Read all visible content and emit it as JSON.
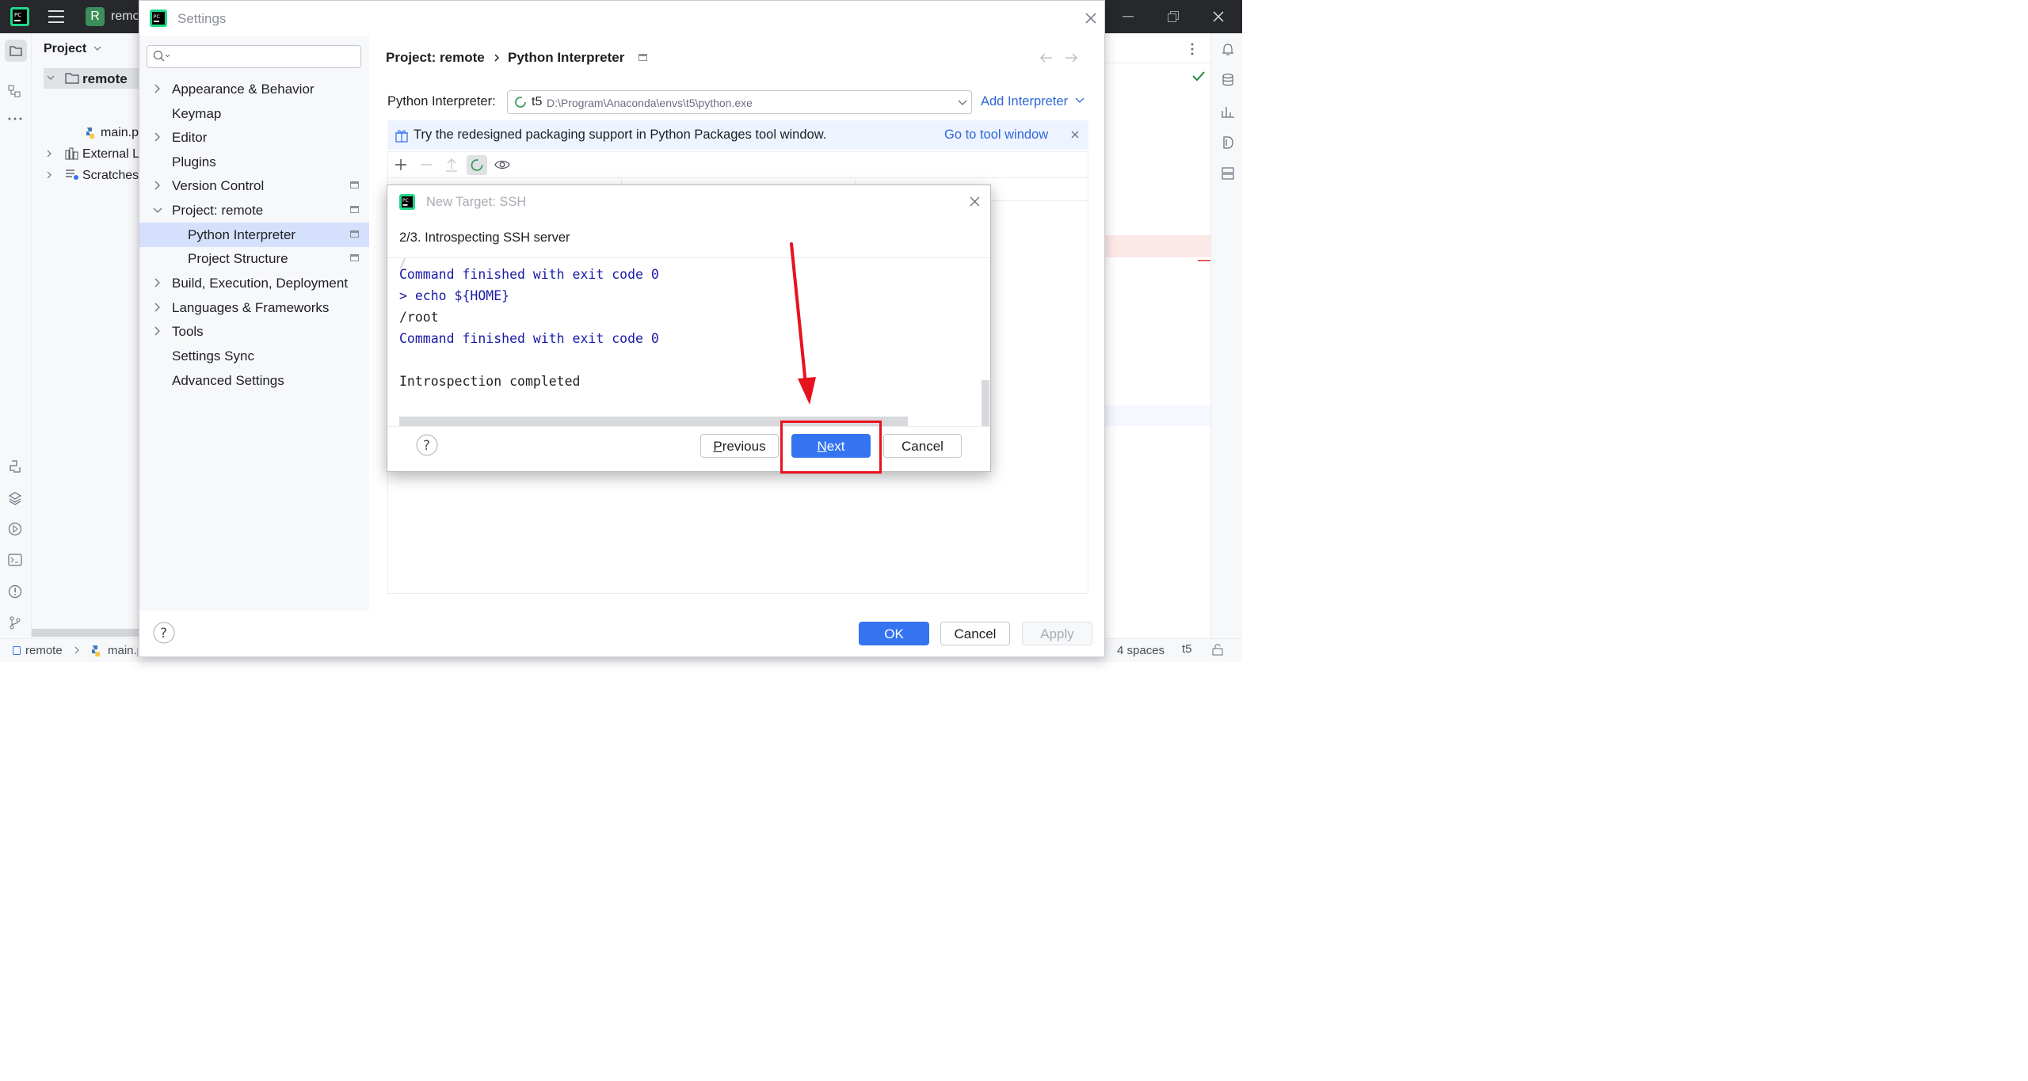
{
  "ide": {
    "project_chip_letter": "R",
    "project_name": "remote",
    "project_panel_title": "Project",
    "tree": [
      {
        "label": "remote"
      },
      {
        "label": "main.py"
      },
      {
        "label": "External Libraries"
      },
      {
        "label": "Scratches and Consoles"
      }
    ],
    "status": {
      "crumb_project": "remote",
      "crumb_file": "main.py",
      "indent": "4 spaces",
      "interpreter": "t5"
    }
  },
  "settings": {
    "title": "Settings",
    "search_placeholder": "",
    "nav": [
      {
        "label": "Appearance & Behavior",
        "expandable": true
      },
      {
        "label": "Keymap"
      },
      {
        "label": "Editor",
        "expandable": true
      },
      {
        "label": "Plugins"
      },
      {
        "label": "Version Control",
        "expandable": true
      },
      {
        "label": "Project: remote",
        "expanded": true
      },
      {
        "label": "Python Interpreter",
        "selected": true
      },
      {
        "label": "Project Structure"
      },
      {
        "label": "Build, Execution, Deployment",
        "expandable": true
      },
      {
        "label": "Languages & Frameworks",
        "expandable": true
      },
      {
        "label": "Tools",
        "expandable": true
      },
      {
        "label": "Settings Sync"
      },
      {
        "label": "Advanced Settings"
      }
    ],
    "breadcrumb": {
      "project": "Project: remote",
      "page": "Python Interpreter"
    },
    "interpreter_label": "Python Interpreter:",
    "interpreter_name": "t5",
    "interpreter_path": "D:\\Program\\Anaconda\\envs\\t5\\python.exe",
    "add_interpreter": "Add Interpreter",
    "banner_text": "Try the redesigned packaging support in Python Packages tool window.",
    "banner_link": "Go to tool window",
    "buttons": {
      "ok": "OK",
      "cancel": "Cancel",
      "apply": "Apply"
    }
  },
  "ssh_dialog": {
    "title": "New Target: SSH",
    "step": "2/3. Introspecting SSH server",
    "log": [
      {
        "text": "Command finished with exit code 0",
        "style": "blue"
      },
      {
        "text": "> echo ${HOME}",
        "style": "blue"
      },
      {
        "text": "/root",
        "style": "plain"
      },
      {
        "text": "Command finished with exit code 0",
        "style": "blue"
      },
      {
        "text": "",
        "style": "plain"
      },
      {
        "text": "Introspection completed",
        "style": "plain"
      }
    ],
    "buttons": {
      "previous": "Previous",
      "next": "Next",
      "cancel": "Cancel"
    }
  },
  "colors": {
    "accent": "#3574f0",
    "annotation": "#e8121e",
    "log_blue": "#1a1aa6",
    "selection": "#d5e1fc"
  }
}
